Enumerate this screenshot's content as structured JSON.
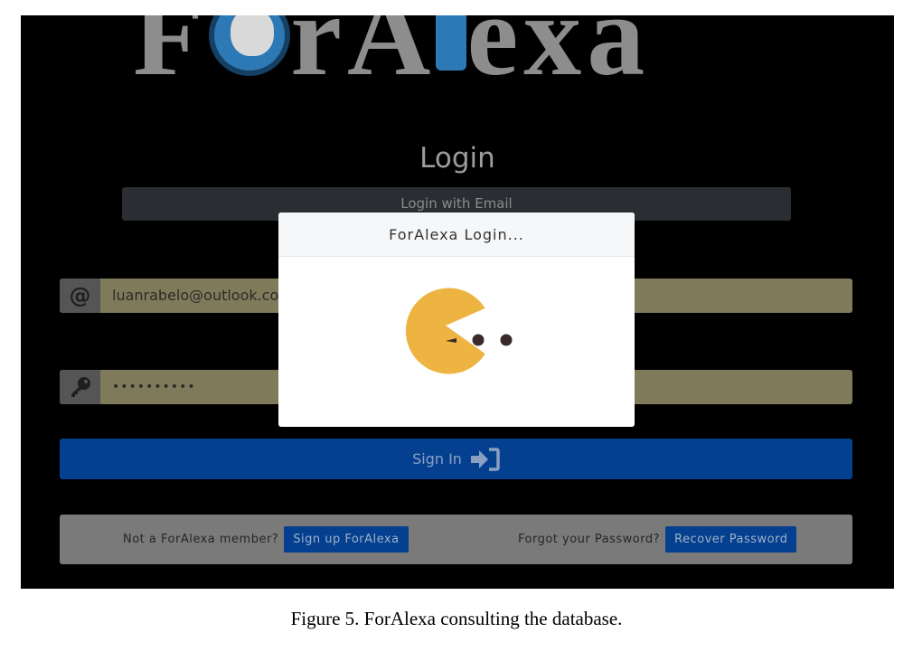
{
  "app": {
    "logo_text": "ForAlexa"
  },
  "page": {
    "title": "Login",
    "login_method_label": "Login with Email"
  },
  "form": {
    "email_icon": "at-sign-icon",
    "email_value": "luanrabelo@outlook.com",
    "password_icon": "key-icon",
    "password_value": "••••••••••",
    "sign_in_label": "Sign In",
    "sign_in_icon": "sign-in-arrow-icon"
  },
  "footer": {
    "member_question": "Not a ForAlexa member?",
    "signup_label": "Sign up ForAlexa",
    "forgot_question": "Forgot your Password?",
    "recover_label": "Recover Password"
  },
  "modal": {
    "title": "ForAlexa Login...",
    "loader_icon": "pacman-loader-icon"
  },
  "caption": "Figure 5. ForAlexa consulting the database.",
  "colors": {
    "primary": "#04408f",
    "loader": "#eeb441",
    "dots": "#3a2a2a"
  }
}
